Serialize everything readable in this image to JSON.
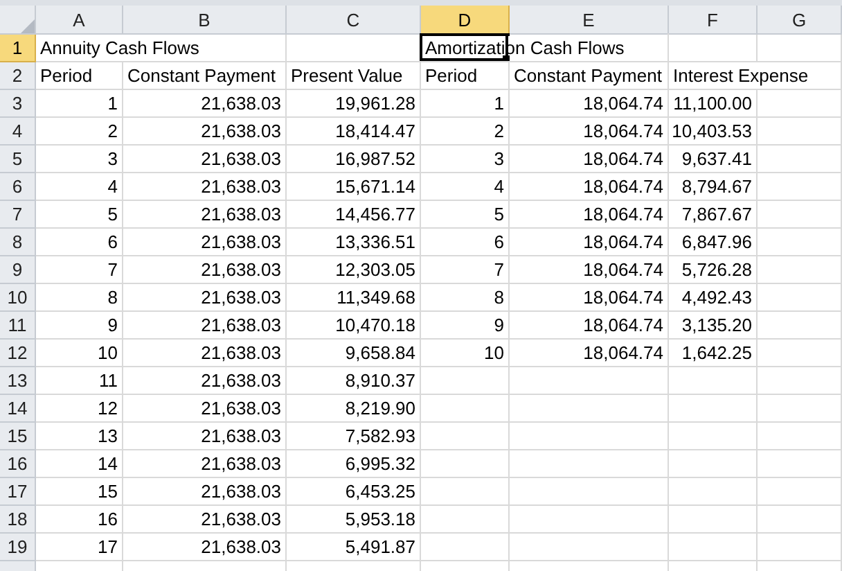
{
  "columns": [
    {
      "label": "A",
      "selected": false
    },
    {
      "label": "B",
      "selected": false
    },
    {
      "label": "C",
      "selected": false
    },
    {
      "label": "D",
      "selected": true
    },
    {
      "label": "E",
      "selected": false
    },
    {
      "label": "F",
      "selected": false
    },
    {
      "label": "G",
      "selected": false
    }
  ],
  "rows": [
    {
      "header": "1",
      "selected": true,
      "cells": [
        {
          "kind": "text",
          "text": "Annuity Cash Flows"
        },
        {
          "kind": "empty"
        },
        {
          "kind": "empty"
        },
        {
          "kind": "text",
          "text": "Amortization Cash Flows"
        },
        {
          "kind": "empty"
        },
        {
          "kind": "empty"
        },
        {
          "kind": "empty"
        }
      ]
    },
    {
      "header": "2",
      "selected": false,
      "cells": [
        {
          "kind": "text",
          "text": "Period"
        },
        {
          "kind": "text",
          "text": "Constant Payment"
        },
        {
          "kind": "text",
          "text": "Present Value"
        },
        {
          "kind": "text",
          "text": "Period"
        },
        {
          "kind": "text",
          "text": "Constant Payment"
        },
        {
          "kind": "text",
          "text": "Interest Expense"
        },
        {
          "kind": "empty"
        }
      ]
    },
    {
      "header": "3",
      "selected": false,
      "cells": [
        {
          "kind": "number",
          "text": "1"
        },
        {
          "kind": "number",
          "text": "21,638.03"
        },
        {
          "kind": "number",
          "text": "19,961.28"
        },
        {
          "kind": "number",
          "text": "1"
        },
        {
          "kind": "number",
          "text": "18,064.74"
        },
        {
          "kind": "number",
          "text": "11,100.00"
        },
        {
          "kind": "empty"
        }
      ]
    },
    {
      "header": "4",
      "selected": false,
      "cells": [
        {
          "kind": "number",
          "text": "2"
        },
        {
          "kind": "number",
          "text": "21,638.03"
        },
        {
          "kind": "number",
          "text": "18,414.47"
        },
        {
          "kind": "number",
          "text": "2"
        },
        {
          "kind": "number",
          "text": "18,064.74"
        },
        {
          "kind": "number",
          "text": "10,403.53"
        },
        {
          "kind": "empty"
        }
      ]
    },
    {
      "header": "5",
      "selected": false,
      "cells": [
        {
          "kind": "number",
          "text": "3"
        },
        {
          "kind": "number",
          "text": "21,638.03"
        },
        {
          "kind": "number",
          "text": "16,987.52"
        },
        {
          "kind": "number",
          "text": "3"
        },
        {
          "kind": "number",
          "text": "18,064.74"
        },
        {
          "kind": "number",
          "text": "9,637.41"
        },
        {
          "kind": "empty"
        }
      ]
    },
    {
      "header": "6",
      "selected": false,
      "cells": [
        {
          "kind": "number",
          "text": "4"
        },
        {
          "kind": "number",
          "text": "21,638.03"
        },
        {
          "kind": "number",
          "text": "15,671.14"
        },
        {
          "kind": "number",
          "text": "4"
        },
        {
          "kind": "number",
          "text": "18,064.74"
        },
        {
          "kind": "number",
          "text": "8,794.67"
        },
        {
          "kind": "empty"
        }
      ]
    },
    {
      "header": "7",
      "selected": false,
      "cells": [
        {
          "kind": "number",
          "text": "5"
        },
        {
          "kind": "number",
          "text": "21,638.03"
        },
        {
          "kind": "number",
          "text": "14,456.77"
        },
        {
          "kind": "number",
          "text": "5"
        },
        {
          "kind": "number",
          "text": "18,064.74"
        },
        {
          "kind": "number",
          "text": "7,867.67"
        },
        {
          "kind": "empty"
        }
      ]
    },
    {
      "header": "8",
      "selected": false,
      "cells": [
        {
          "kind": "number",
          "text": "6"
        },
        {
          "kind": "number",
          "text": "21,638.03"
        },
        {
          "kind": "number",
          "text": "13,336.51"
        },
        {
          "kind": "number",
          "text": "6"
        },
        {
          "kind": "number",
          "text": "18,064.74"
        },
        {
          "kind": "number",
          "text": "6,847.96"
        },
        {
          "kind": "empty"
        }
      ]
    },
    {
      "header": "9",
      "selected": false,
      "cells": [
        {
          "kind": "number",
          "text": "7"
        },
        {
          "kind": "number",
          "text": "21,638.03"
        },
        {
          "kind": "number",
          "text": "12,303.05"
        },
        {
          "kind": "number",
          "text": "7"
        },
        {
          "kind": "number",
          "text": "18,064.74"
        },
        {
          "kind": "number",
          "text": "5,726.28"
        },
        {
          "kind": "empty"
        }
      ]
    },
    {
      "header": "10",
      "selected": false,
      "cells": [
        {
          "kind": "number",
          "text": "8"
        },
        {
          "kind": "number",
          "text": "21,638.03"
        },
        {
          "kind": "number",
          "text": "11,349.68"
        },
        {
          "kind": "number",
          "text": "8"
        },
        {
          "kind": "number",
          "text": "18,064.74"
        },
        {
          "kind": "number",
          "text": "4,492.43"
        },
        {
          "kind": "empty"
        }
      ]
    },
    {
      "header": "11",
      "selected": false,
      "cells": [
        {
          "kind": "number",
          "text": "9"
        },
        {
          "kind": "number",
          "text": "21,638.03"
        },
        {
          "kind": "number",
          "text": "10,470.18"
        },
        {
          "kind": "number",
          "text": "9"
        },
        {
          "kind": "number",
          "text": "18,064.74"
        },
        {
          "kind": "number",
          "text": "3,135.20"
        },
        {
          "kind": "empty"
        }
      ]
    },
    {
      "header": "12",
      "selected": false,
      "cells": [
        {
          "kind": "number",
          "text": "10"
        },
        {
          "kind": "number",
          "text": "21,638.03"
        },
        {
          "kind": "number",
          "text": "9,658.84"
        },
        {
          "kind": "number",
          "text": "10"
        },
        {
          "kind": "number",
          "text": "18,064.74"
        },
        {
          "kind": "number",
          "text": "1,642.25"
        },
        {
          "kind": "empty"
        }
      ]
    },
    {
      "header": "13",
      "selected": false,
      "cells": [
        {
          "kind": "number",
          "text": "11"
        },
        {
          "kind": "number",
          "text": "21,638.03"
        },
        {
          "kind": "number",
          "text": "8,910.37"
        },
        {
          "kind": "empty"
        },
        {
          "kind": "empty"
        },
        {
          "kind": "empty"
        },
        {
          "kind": "empty"
        }
      ]
    },
    {
      "header": "14",
      "selected": false,
      "cells": [
        {
          "kind": "number",
          "text": "12"
        },
        {
          "kind": "number",
          "text": "21,638.03"
        },
        {
          "kind": "number",
          "text": "8,219.90"
        },
        {
          "kind": "empty"
        },
        {
          "kind": "empty"
        },
        {
          "kind": "empty"
        },
        {
          "kind": "empty"
        }
      ]
    },
    {
      "header": "15",
      "selected": false,
      "cells": [
        {
          "kind": "number",
          "text": "13"
        },
        {
          "kind": "number",
          "text": "21,638.03"
        },
        {
          "kind": "number",
          "text": "7,582.93"
        },
        {
          "kind": "empty"
        },
        {
          "kind": "empty"
        },
        {
          "kind": "empty"
        },
        {
          "kind": "empty"
        }
      ]
    },
    {
      "header": "16",
      "selected": false,
      "cells": [
        {
          "kind": "number",
          "text": "14"
        },
        {
          "kind": "number",
          "text": "21,638.03"
        },
        {
          "kind": "number",
          "text": "6,995.32"
        },
        {
          "kind": "empty"
        },
        {
          "kind": "empty"
        },
        {
          "kind": "empty"
        },
        {
          "kind": "empty"
        }
      ]
    },
    {
      "header": "17",
      "selected": false,
      "cells": [
        {
          "kind": "number",
          "text": "15"
        },
        {
          "kind": "number",
          "text": "21,638.03"
        },
        {
          "kind": "number",
          "text": "6,453.25"
        },
        {
          "kind": "empty"
        },
        {
          "kind": "empty"
        },
        {
          "kind": "empty"
        },
        {
          "kind": "empty"
        }
      ]
    },
    {
      "header": "18",
      "selected": false,
      "cells": [
        {
          "kind": "number",
          "text": "16"
        },
        {
          "kind": "number",
          "text": "21,638.03"
        },
        {
          "kind": "number",
          "text": "5,953.18"
        },
        {
          "kind": "empty"
        },
        {
          "kind": "empty"
        },
        {
          "kind": "empty"
        },
        {
          "kind": "empty"
        }
      ]
    },
    {
      "header": "19",
      "selected": false,
      "cells": [
        {
          "kind": "number",
          "text": "17"
        },
        {
          "kind": "number",
          "text": "21,638.03"
        },
        {
          "kind": "number",
          "text": "5,491.87"
        },
        {
          "kind": "empty"
        },
        {
          "kind": "empty"
        },
        {
          "kind": "empty"
        },
        {
          "kind": "empty"
        }
      ]
    }
  ]
}
